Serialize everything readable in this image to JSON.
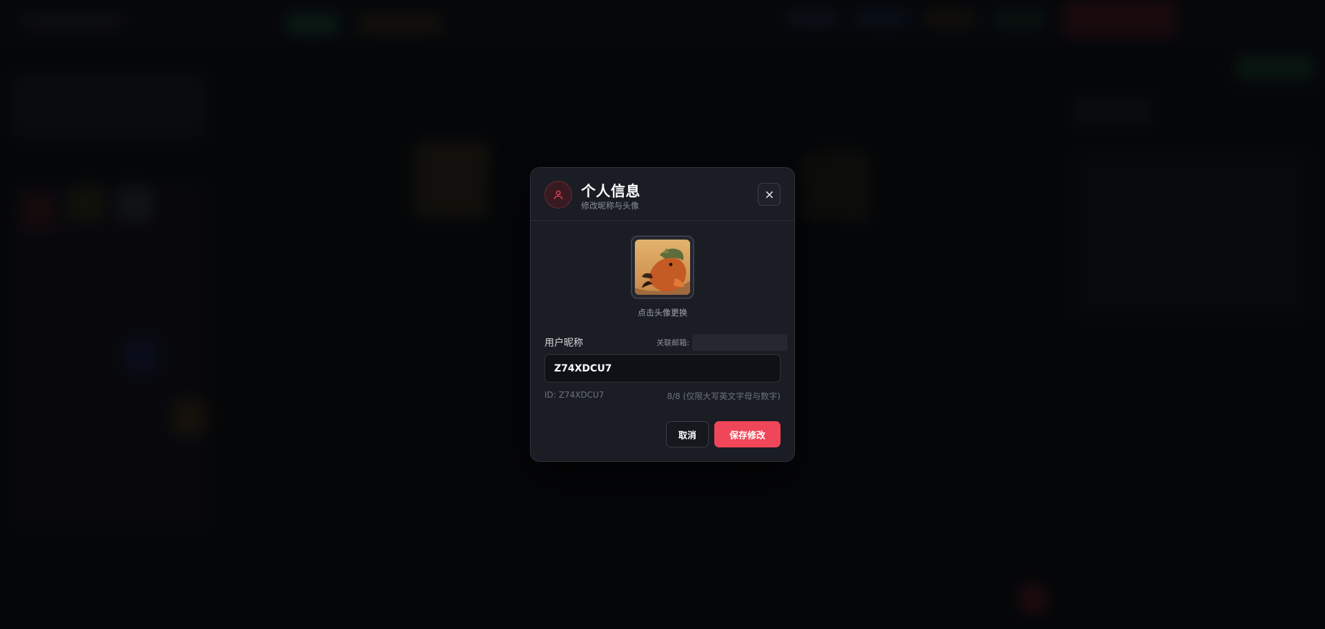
{
  "modal": {
    "title": "个人信息",
    "subtitle": "修改昵称与头像",
    "avatar_caption": "点击头像更换",
    "nickname_label": "用户昵称",
    "email_label": "关联邮箱:",
    "email_value": "",
    "nickname_value": "Z74XDCU7",
    "id_text": "ID: Z74XDCU7",
    "count_text": "8/8 (仅限大写英文字母与数字)",
    "cancel_label": "取消",
    "save_label": "保存修改"
  },
  "colors": {
    "accent": "#f04659",
    "modal_bg": "#1a1d24",
    "page_bg": "#07080b"
  },
  "icons": {
    "header": "user-icon",
    "close": "close-icon"
  }
}
